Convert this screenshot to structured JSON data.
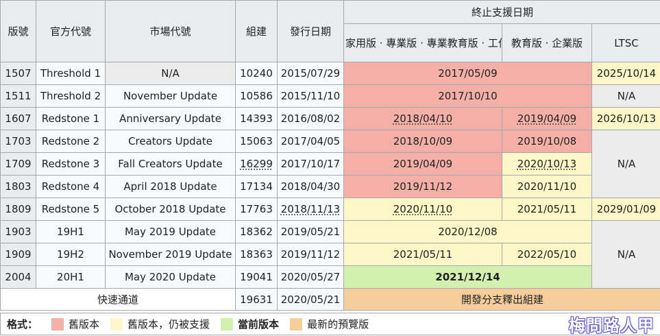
{
  "headers": {
    "version": "版號",
    "codename": "官方代號",
    "marketing": "市場代號",
    "build": "組建",
    "release_date": "發行日期",
    "eos_group": "終止支援日期",
    "home_pro": "家用版 · 專業版 · 專業教育版 · 工作站專業版",
    "edu_ent": "教育版 · 企業版",
    "ltsc": "LTSC"
  },
  "rows": [
    {
      "version": "1507",
      "codename": "Threshold 1",
      "marketing": "N/A",
      "build": "10240",
      "release": "2015/07/29",
      "home_pro": "2017/05/09",
      "ltsc": "2025/10/14"
    },
    {
      "version": "1511",
      "codename": "Threshold 2",
      "marketing": "November Update",
      "build": "10586",
      "release": "2015/11/10",
      "home_pro": "2017/10/10",
      "ltsc": "N/A"
    },
    {
      "version": "1607",
      "codename": "Redstone 1",
      "marketing": "Anniversary Update",
      "build": "14393",
      "release": "2016/08/02",
      "home_pro": "2018/04/10",
      "edu_ent": "2019/04/09",
      "ltsc": "2026/10/13"
    },
    {
      "version": "1703",
      "codename": "Redstone 2",
      "marketing": "Creators Update",
      "build": "15063",
      "release": "2017/04/05",
      "home_pro": "2018/10/09",
      "edu_ent": "2019/10/08",
      "ltsc": "N/A"
    },
    {
      "version": "1709",
      "codename": "Redstone 3",
      "marketing": "Fall Creators Update",
      "build": "16299",
      "release": "2017/10/17",
      "home_pro": "2019/04/09",
      "edu_ent": "2020/10/13"
    },
    {
      "version": "1803",
      "codename": "Redstone 4",
      "marketing": "April 2018 Update",
      "build": "17134",
      "release": "2018/04/30",
      "home_pro": "2019/11/12",
      "edu_ent": "2020/11/10"
    },
    {
      "version": "1809",
      "codename": "Redstone 5",
      "marketing": "October 2018 Update",
      "build": "17763",
      "release": "2018/11/13",
      "home_pro": "2020/11/10",
      "edu_ent": "2021/05/11",
      "ltsc": "2029/01/09"
    },
    {
      "version": "1903",
      "codename": "19H1",
      "marketing": "May 2019 Update",
      "build": "18362",
      "release": "2019/05/21",
      "home_pro": "2020/12/08",
      "ltsc": "N/A"
    },
    {
      "version": "1909",
      "codename": "19H2",
      "marketing": "November 2019 Update",
      "build": "18363",
      "release": "2019/11/12",
      "home_pro": "2021/05/11",
      "edu_ent": "2022/05/10"
    },
    {
      "version": "2004",
      "codename": "20H1",
      "marketing": "May 2020 Update",
      "build": "19041",
      "release": "2020/05/27",
      "home_pro": "2021/12/14"
    },
    {
      "label": "快速通道",
      "build": "19631",
      "release": "2020/05/21",
      "home_pro": "開發分支釋出組建"
    }
  ],
  "legend": {
    "title": "格式：",
    "old": "舊版本",
    "supported": "舊版本，仍被支援",
    "current": "當前版本",
    "preview": "最新的預覽版"
  },
  "colors": {
    "old": "#f4b0a6",
    "supported": "#fbf7c6",
    "current": "#d4f0b0",
    "preview": "#f7ce9b",
    "na": "#ececec",
    "header": "#eaecf0"
  },
  "watermark": "梅問路人甲"
}
